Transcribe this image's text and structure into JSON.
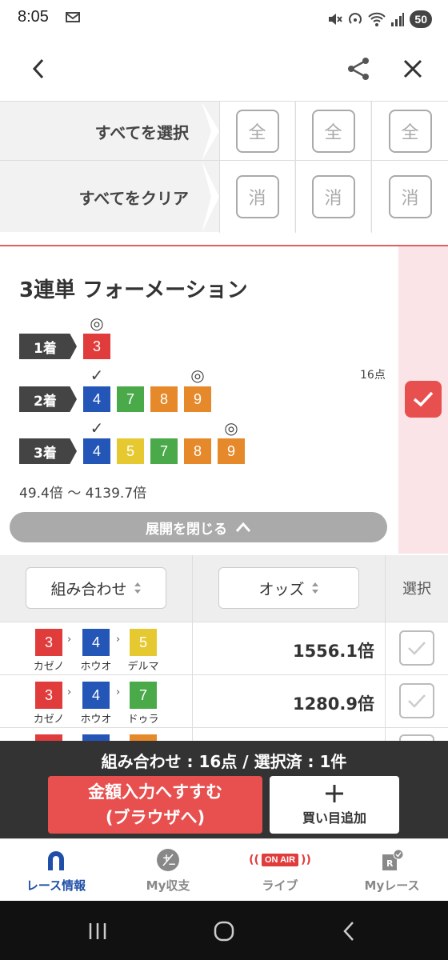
{
  "status": {
    "time": "8:05",
    "battery": "50"
  },
  "colors": {
    "red": "#e03c3c",
    "blue": "#2456b8",
    "green": "#4aaa4a",
    "orange": "#e5892a",
    "yellow": "#e6c930",
    "accent": "#e85050"
  },
  "select_rows": {
    "select_all": {
      "label": "すべてを選択",
      "btn": "全"
    },
    "clear_all": {
      "label": "すべてをクリア",
      "btn": "消"
    }
  },
  "formation": {
    "title": "3連単 フォーメーション",
    "points": "16点",
    "first": {
      "label": "1着",
      "nums": [
        "3"
      ]
    },
    "second": {
      "label": "2着",
      "nums": [
        "4",
        "7",
        "8",
        "9"
      ]
    },
    "third": {
      "label": "3着",
      "nums": [
        "4",
        "5",
        "7",
        "8",
        "9"
      ]
    },
    "odds_range": "49.4倍 〜 4139.7倍",
    "collapse": "展開を閉じる"
  },
  "table": {
    "col_combo": "組み合わせ",
    "col_odds": "オッズ",
    "col_select": "選択",
    "rows": [
      {
        "n1": "3",
        "name1": "カゼノ",
        "n2": "4",
        "name2": "ホウオ",
        "n3": "5",
        "name3": "デルマ",
        "odds": "1556.1倍"
      },
      {
        "n1": "3",
        "name1": "カゼノ",
        "n2": "4",
        "name2": "ホウオ",
        "n3": "7",
        "name3": "ドゥラ",
        "odds": "1280.9倍"
      }
    ]
  },
  "bottom": {
    "summary": "組み合わせ : 16点 / 選択済 : 1件",
    "pay_line1": "金額入力へすすむ",
    "pay_line2": "(ブラウザへ)",
    "add_label": "買い目追加"
  },
  "tabs": [
    {
      "label": "レース情報",
      "icon": "horseshoe-icon"
    },
    {
      "label": "My収支",
      "icon": "plus-minus-icon"
    },
    {
      "label": "ライブ",
      "icon": "on-air-icon",
      "badge": "ON AIR"
    },
    {
      "label": "Myレース",
      "icon": "my-race-icon"
    }
  ]
}
